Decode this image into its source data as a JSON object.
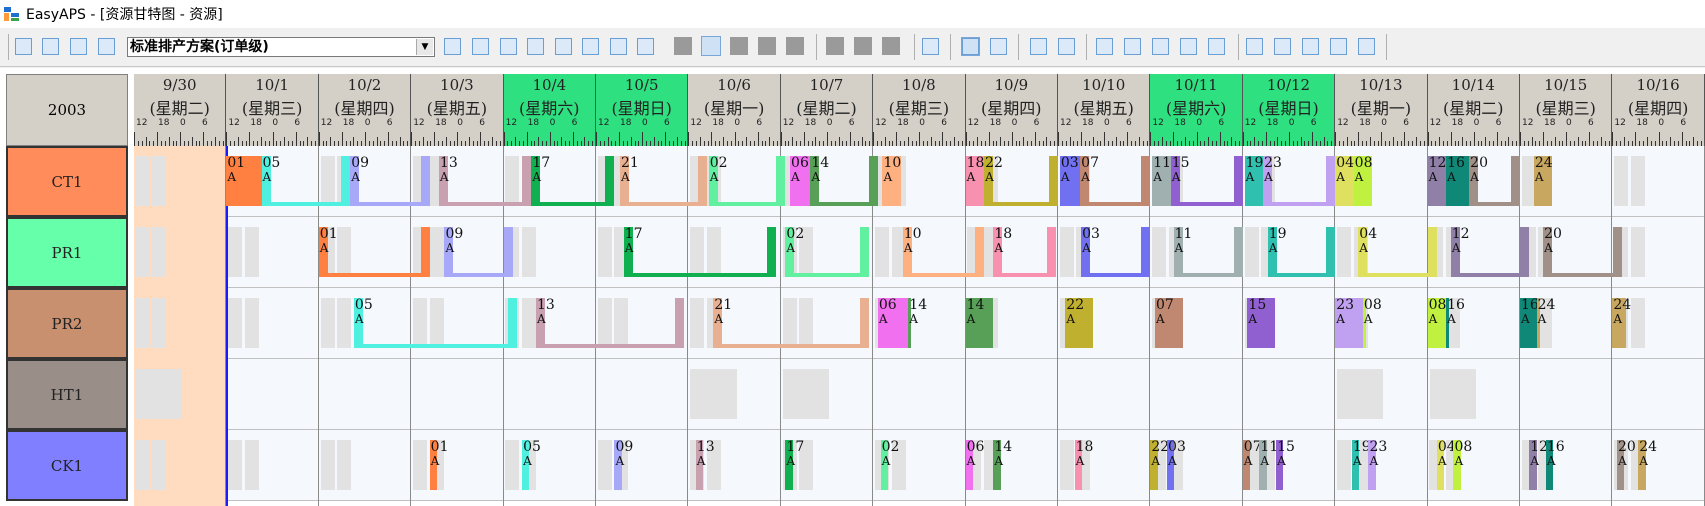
{
  "window": {
    "title": "EasyAPS - [资源甘特图 - 资源]"
  },
  "toolbar": {
    "plan_select": "标准排产方案(订单级)",
    "dropdown_arrow": "▼"
  },
  "gantt": {
    "year": "2003",
    "hour_labels": [
      "12",
      "18",
      "0",
      "6"
    ],
    "days": [
      {
        "date": "9/30",
        "weekday": "(星期二)",
        "weekend": false
      },
      {
        "date": "10/1",
        "weekday": "(星期三)",
        "weekend": false
      },
      {
        "date": "10/2",
        "weekday": "(星期四)",
        "weekend": false
      },
      {
        "date": "10/3",
        "weekday": "(星期五)",
        "weekend": false
      },
      {
        "date": "10/4",
        "weekday": "(星期六)",
        "weekend": true
      },
      {
        "date": "10/5",
        "weekday": "(星期日)",
        "weekend": true
      },
      {
        "date": "10/6",
        "weekday": "(星期一)",
        "weekend": false
      },
      {
        "date": "10/7",
        "weekday": "(星期二)",
        "weekend": false
      },
      {
        "date": "10/8",
        "weekday": "(星期三)",
        "weekend": false
      },
      {
        "date": "10/9",
        "weekday": "(星期四)",
        "weekend": false
      },
      {
        "date": "10/10",
        "weekday": "(星期五)",
        "weekend": false
      },
      {
        "date": "10/11",
        "weekday": "(星期六)",
        "weekend": true
      },
      {
        "date": "10/12",
        "weekday": "(星期日)",
        "weekend": true
      },
      {
        "date": "10/13",
        "weekday": "(星期一)",
        "weekend": false
      },
      {
        "date": "10/14",
        "weekday": "(星期二)",
        "weekend": false
      },
      {
        "date": "10/15",
        "weekday": "(星期三)",
        "weekend": false
      },
      {
        "date": "10/16",
        "weekday": "(星期四)",
        "weekend": false
      }
    ],
    "resources": [
      {
        "name": "CT1",
        "color": "#ff8c5a"
      },
      {
        "name": "PR1",
        "color": "#66ffaa"
      },
      {
        "name": "PR2",
        "color": "#c8906e"
      },
      {
        "name": "HT1",
        "color": "#9a8f88"
      },
      {
        "name": "CK1",
        "color": "#7f7fff"
      }
    ],
    "colors": {
      "01": "#ff8040",
      "05": "#50f0e0",
      "09": "#a8a8f8",
      "13": "#c8a0b0",
      "17": "#10b050",
      "21": "#e8b090",
      "02": "#60f0a0",
      "06": "#f070f0",
      "14": "#58a058",
      "10": "#ffb080",
      "18": "#f890b0",
      "22": "#c0b030",
      "03": "#7070f0",
      "07": "#c08870",
      "11": "#a0b0b0",
      "15": "#9060d0",
      "19": "#30c0b0",
      "23": "#c0a0f0",
      "04": "#e0e060",
      "08": "#c0f040",
      "12": "#9080a8",
      "16": "#108878",
      "20": "#a09088",
      "24": "#c8a860"
    },
    "tasks": {
      "CT1": [
        {
          "id": "01",
          "mark": "A",
          "start": 1.0,
          "end": 1.38,
          "thick": true
        },
        {
          "id": "05",
          "mark": "A",
          "start": 1.38,
          "end": 2.34,
          "bracket": true
        },
        {
          "id": "09",
          "mark": "A",
          "start": 2.34,
          "end": 3.2,
          "bracket": true
        },
        {
          "id": "13",
          "mark": "A",
          "start": 3.3,
          "end": 4.3,
          "bracket": true
        },
        {
          "id": "17",
          "mark": "A",
          "start": 4.3,
          "end": 5.2,
          "bracket": true
        },
        {
          "id": "21",
          "mark": "A",
          "start": 5.26,
          "end": 6.2,
          "bracket": true
        },
        {
          "id": "02",
          "mark": "A",
          "start": 6.22,
          "end": 7.05,
          "bracket": true
        },
        {
          "id": "06",
          "mark": "A",
          "start": 7.1,
          "end": 7.32,
          "thick": true
        },
        {
          "id": "14",
          "mark": "A",
          "start": 7.32,
          "end": 8.05,
          "bracket": true
        },
        {
          "id": "10",
          "mark": "A",
          "start": 8.1,
          "end": 8.3,
          "thick": true
        },
        {
          "id": "18",
          "mark": "A",
          "start": 9.0,
          "end": 9.2,
          "thick": true
        },
        {
          "id": "22",
          "mark": "A",
          "start": 9.2,
          "end": 10.0,
          "bracket": true
        },
        {
          "id": "03",
          "mark": "A",
          "start": 10.02,
          "end": 10.24,
          "thick": true
        },
        {
          "id": "07",
          "mark": "A",
          "start": 10.24,
          "end": 11.0,
          "bracket": true
        },
        {
          "id": "11",
          "mark": "A",
          "start": 11.02,
          "end": 11.22,
          "thick": true
        },
        {
          "id": "15",
          "mark": "A",
          "start": 11.22,
          "end": 12.0,
          "bracket": true
        },
        {
          "id": "19",
          "mark": "A",
          "start": 12.02,
          "end": 12.22,
          "thick": true
        },
        {
          "id": "23",
          "mark": "A",
          "start": 12.22,
          "end": 13.0,
          "bracket": true
        },
        {
          "id": "04",
          "mark": "A",
          "start": 13.0,
          "end": 13.2,
          "thick": true
        },
        {
          "id": "08",
          "mark": "A",
          "start": 13.2,
          "end": 13.4,
          "thick": true
        },
        {
          "id": "12",
          "mark": "A",
          "start": 14.0,
          "end": 14.2,
          "thick": true
        },
        {
          "id": "16",
          "mark": "A",
          "start": 14.2,
          "end": 14.45,
          "thick": true
        },
        {
          "id": "20",
          "mark": "A",
          "start": 14.45,
          "end": 15.0,
          "bracket": true
        },
        {
          "id": "24",
          "mark": "A",
          "start": 15.15,
          "end": 15.35,
          "thick": true
        }
      ],
      "PR1": [
        {
          "id": "01",
          "mark": "A",
          "start": 2.0,
          "end": 3.2,
          "bracket": true
        },
        {
          "id": "09",
          "mark": "A",
          "start": 3.36,
          "end": 4.1,
          "bracket": true
        },
        {
          "id": "17",
          "mark": "A",
          "start": 5.3,
          "end": 6.95,
          "bracket": true
        },
        {
          "id": "02",
          "mark": "A",
          "start": 7.05,
          "end": 7.95,
          "bracket": true
        },
        {
          "id": "10",
          "mark": "A",
          "start": 8.32,
          "end": 9.2,
          "bracket": true
        },
        {
          "id": "18",
          "mark": "A",
          "start": 9.3,
          "end": 9.98,
          "bracket": true
        },
        {
          "id": "03",
          "mark": "A",
          "start": 10.25,
          "end": 11.0,
          "bracket": true
        },
        {
          "id": "11",
          "mark": "A",
          "start": 11.25,
          "end": 12.0,
          "bracket": true
        },
        {
          "id": "19",
          "mark": "A",
          "start": 12.27,
          "end": 13.0,
          "bracket": true
        },
        {
          "id": "04",
          "mark": "A",
          "start": 13.25,
          "end": 14.1,
          "bracket": true
        },
        {
          "id": "12",
          "mark": "A",
          "start": 14.25,
          "end": 15.1,
          "bracket": true
        },
        {
          "id": "20",
          "mark": "A",
          "start": 15.25,
          "end": 16.1,
          "bracket": true
        }
      ],
      "PR2": [
        {
          "id": "05",
          "mark": "A",
          "start": 2.38,
          "end": 4.15,
          "bracket": true
        },
        {
          "id": "13",
          "mark": "A",
          "start": 4.35,
          "end": 5.95,
          "bracket": true
        },
        {
          "id": "21",
          "mark": "A",
          "start": 6.27,
          "end": 7.95,
          "bracket": true
        },
        {
          "id": "06",
          "mark": "A",
          "start": 8.05,
          "end": 8.38,
          "thick": true
        },
        {
          "id": "14",
          "mark": "A",
          "start": 8.38,
          "end": 8.55,
          "bracket": false
        },
        {
          "id": "14",
          "mark": "A",
          "start": 9.0,
          "end": 9.3,
          "thick": true
        },
        {
          "id": "22",
          "mark": "A",
          "start": 10.08,
          "end": 10.38,
          "thick": true
        },
        {
          "id": "07",
          "mark": "A",
          "start": 11.05,
          "end": 11.35,
          "thick": true
        },
        {
          "id": "15",
          "mark": "A",
          "start": 12.05,
          "end": 12.35,
          "thick": true
        },
        {
          "id": "23",
          "mark": "A",
          "start": 13.0,
          "end": 13.3,
          "thick": true
        },
        {
          "id": "08",
          "mark": "A",
          "start": 13.3,
          "end": 13.5,
          "bracket": false
        },
        {
          "id": "08",
          "mark": "A",
          "start": 14.0,
          "end": 14.2,
          "thick": true
        },
        {
          "id": "16",
          "mark": "A",
          "start": 14.2,
          "end": 14.4,
          "bracket": false
        },
        {
          "id": "16",
          "mark": "A",
          "start": 15.0,
          "end": 15.18,
          "thick": true
        },
        {
          "id": "24",
          "mark": "A",
          "start": 15.18,
          "end": 15.4,
          "bracket": false
        },
        {
          "id": "24",
          "mark": "A",
          "start": 16.0,
          "end": 16.15,
          "thick": true
        }
      ],
      "HT1": [],
      "CK1": [
        {
          "id": "01",
          "mark": "A",
          "start": 3.2,
          "end": 3.28,
          "thick": true
        },
        {
          "id": "05",
          "mark": "A",
          "start": 4.2,
          "end": 4.28,
          "thick": true
        },
        {
          "id": "09",
          "mark": "A",
          "start": 5.2,
          "end": 5.28,
          "thick": true
        },
        {
          "id": "13",
          "mark": "A",
          "start": 6.08,
          "end": 6.16,
          "thick": true
        },
        {
          "id": "17",
          "mark": "A",
          "start": 7.05,
          "end": 7.13,
          "thick": true
        },
        {
          "id": "02",
          "mark": "A",
          "start": 8.08,
          "end": 8.16,
          "thick": true
        },
        {
          "id": "06",
          "mark": "A",
          "start": 9.0,
          "end": 9.08,
          "thick": true
        },
        {
          "id": "14",
          "mark": "A",
          "start": 9.3,
          "end": 9.38,
          "thick": true
        },
        {
          "id": "18",
          "mark": "A",
          "start": 10.18,
          "end": 10.26,
          "thick": true
        },
        {
          "id": "22",
          "mark": "A",
          "start": 11.0,
          "end": 11.08,
          "thick": true
        },
        {
          "id": "03",
          "mark": "A",
          "start": 11.18,
          "end": 11.26,
          "thick": true
        },
        {
          "id": "07",
          "mark": "A",
          "start": 12.0,
          "end": 12.08,
          "thick": true
        },
        {
          "id": "11",
          "mark": "A",
          "start": 12.18,
          "end": 12.26,
          "thick": true
        },
        {
          "id": "15",
          "mark": "A",
          "start": 12.36,
          "end": 12.44,
          "thick": true
        },
        {
          "id": "19",
          "mark": "A",
          "start": 13.18,
          "end": 13.26,
          "thick": true
        },
        {
          "id": "23",
          "mark": "A",
          "start": 13.36,
          "end": 13.44,
          "thick": true
        },
        {
          "id": "04",
          "mark": "A",
          "start": 14.1,
          "end": 14.18,
          "thick": true
        },
        {
          "id": "08",
          "mark": "A",
          "start": 14.28,
          "end": 14.36,
          "thick": true
        },
        {
          "id": "12",
          "mark": "A",
          "start": 15.1,
          "end": 15.18,
          "thick": true
        },
        {
          "id": "16",
          "mark": "A",
          "start": 15.28,
          "end": 15.36,
          "thick": true
        },
        {
          "id": "20",
          "mark": "A",
          "start": 16.05,
          "end": 16.13,
          "thick": true
        },
        {
          "id": "24",
          "mark": "A",
          "start": 16.28,
          "end": 16.36,
          "thick": true
        }
      ]
    }
  }
}
